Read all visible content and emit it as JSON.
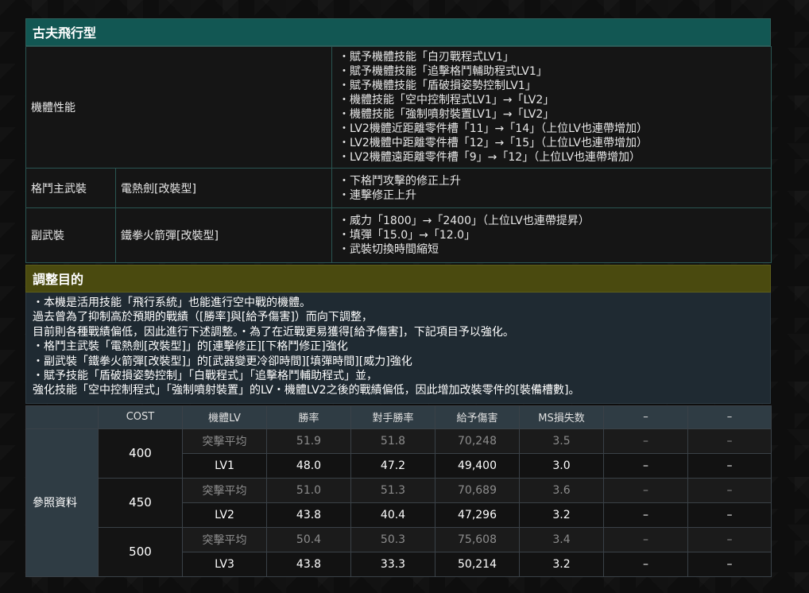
{
  "title": "古夫飛行型",
  "spec": {
    "performance": {
      "label": "機體性能",
      "items": [
        "・賦予機體技能「白刃戰程式LV1」",
        "・賦予機體技能「追擊格鬥輔助程式LV1」",
        "・賦予機體技能「盾破損姿勢控制LV1」",
        "・機體技能「空中控制程式LV1」→「LV2」",
        "・機體技能「強制噴射裝置LV1」→「LV2」",
        "・LV2機體近距離零件槽「11」→「14」（上位LV也連帶增加）",
        "・LV2機體中距離零件槽「12」→「15」（上位LV也連帶增加）",
        "・LV2機體遠距離零件槽「9」→「12」（上位LV也連帶增加）"
      ]
    },
    "melee": {
      "label": "格鬥主武裝",
      "weapon": "電熱劍[改裝型]",
      "items": [
        "・下格鬥攻擊的修正上升",
        "・連擊修正上升"
      ]
    },
    "sub": {
      "label": "副武裝",
      "weapon": "鐵拳火箭彈[改裝型]",
      "items": [
        "・威力「1800」→「2400」（上位LV也連帶提昇）",
        "・填彈「15.0」→「12.0」",
        "・武裝切換時間縮短"
      ]
    }
  },
  "purpose": {
    "title": "調整目的",
    "lines": [
      "・本機是活用技能「飛行系統」也能進行空中戰的機體。",
      "過去曾為了抑制高於預期的戰績（[勝率]與[給予傷害]）而向下調整，",
      "目前則各種戰績偏低，因此進行下述調整。・為了在近戰更易獲得[給予傷害]，下記項目予以強化。",
      "・格鬥主武裝「電熱劍[改裝型]」的[連擊修正][下格鬥修正]強化",
      "・副武裝「鐵拳火箭彈[改裝型]」的[武器變更冷卻時間][填彈時間][威力]強化",
      "・賦予技能「盾破損姿勢控制」「白戰程式」「追擊格鬥輔助程式」並，",
      "強化技能「空中控制程式」「強制噴射裝置」的LV・機體LV2之後的戰績偏低，因此增加改裝零件的[裝備槽數]。"
    ]
  },
  "reference": {
    "label": "參照資料",
    "headers": [
      "COST",
      "機體LV",
      "勝率",
      "對手勝率",
      "給予傷害",
      "MS損失数",
      "–",
      "–"
    ],
    "groups": [
      {
        "cost": "400",
        "rows": [
          {
            "lv": "突擊平均",
            "win": "51.9",
            "opp": "51.8",
            "dmg": "70,248",
            "loss": "3.5",
            "c7": "–",
            "c8": "–"
          },
          {
            "lv": "LV1",
            "win": "48.0",
            "opp": "47.2",
            "dmg": "49,400",
            "loss": "3.0",
            "c7": "–",
            "c8": "–"
          }
        ]
      },
      {
        "cost": "450",
        "rows": [
          {
            "lv": "突擊平均",
            "win": "51.0",
            "opp": "51.3",
            "dmg": "70,689",
            "loss": "3.6",
            "c7": "–",
            "c8": "–"
          },
          {
            "lv": "LV2",
            "win": "43.8",
            "opp": "40.4",
            "dmg": "47,296",
            "loss": "3.2",
            "c7": "–",
            "c8": "–"
          }
        ]
      },
      {
        "cost": "500",
        "rows": [
          {
            "lv": "突擊平均",
            "win": "50.4",
            "opp": "50.3",
            "dmg": "75,608",
            "loss": "3.4",
            "c7": "–",
            "c8": "–"
          },
          {
            "lv": "LV3",
            "win": "43.8",
            "opp": "33.3",
            "dmg": "50,214",
            "loss": "3.2",
            "c7": "–",
            "c8": "–"
          }
        ]
      }
    ]
  }
}
